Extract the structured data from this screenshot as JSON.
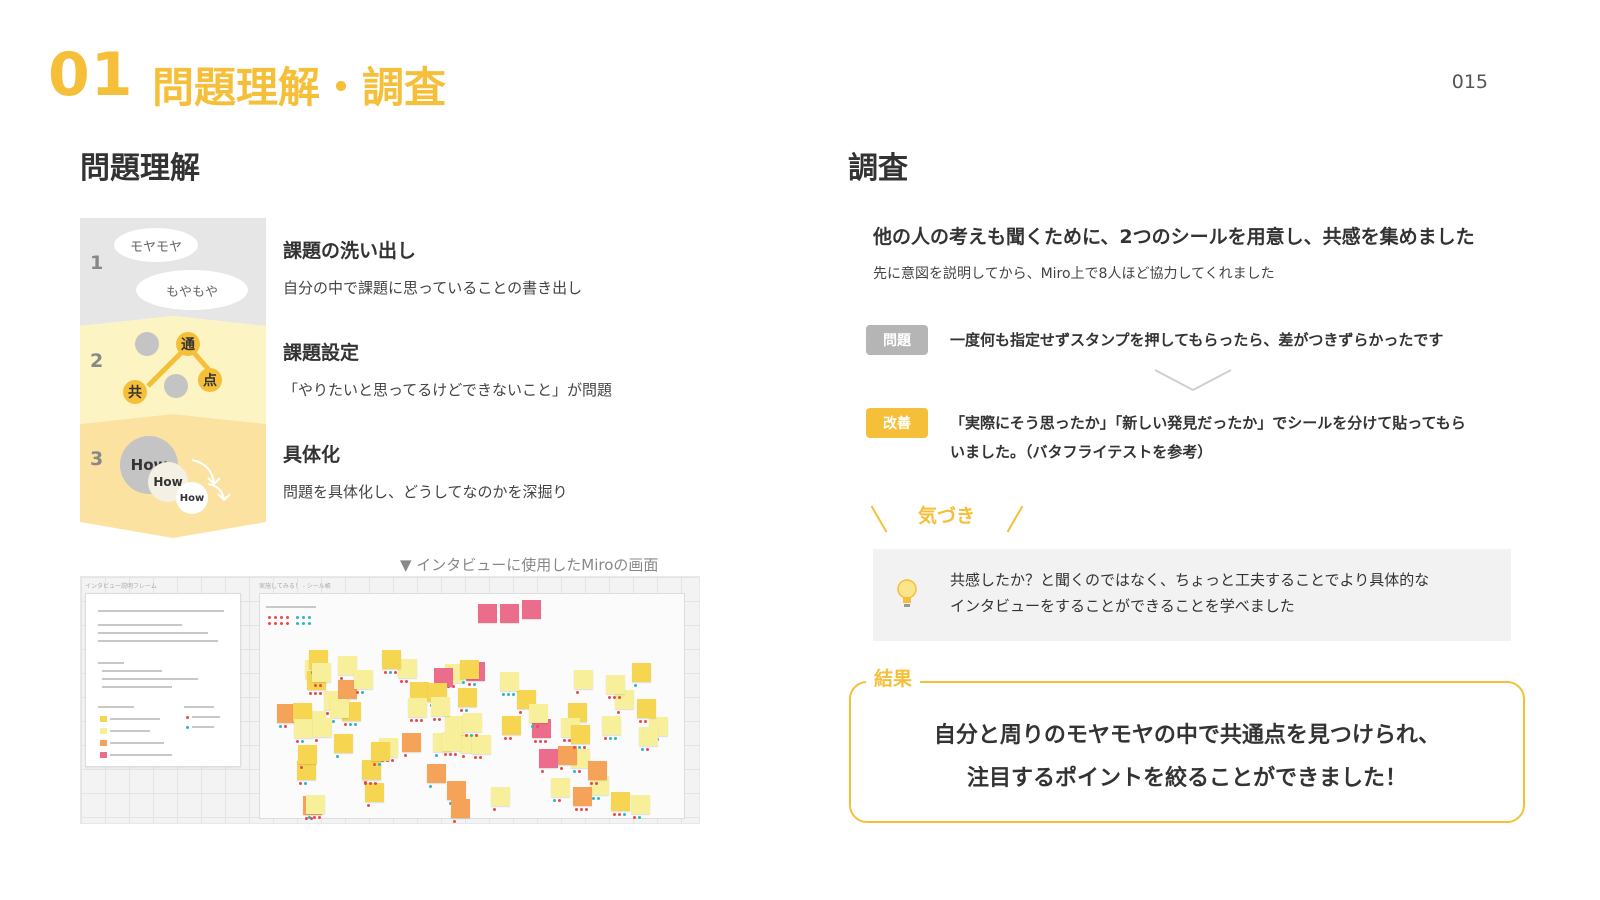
{
  "header": {
    "number": "01",
    "title": "問題理解・調査",
    "page": "015"
  },
  "left": {
    "title": "問題理解",
    "stages": [
      {
        "num": "1",
        "clouds": [
          "モヤモヤ",
          "もやもや"
        ]
      },
      {
        "num": "2",
        "nodes": [
          "通",
          "共",
          "点"
        ]
      },
      {
        "num": "3",
        "hows": [
          "How",
          "How",
          "How"
        ]
      }
    ],
    "steps": [
      {
        "title": "課題の洗い出し",
        "desc": "自分の中で課題に思っていることの書き出し"
      },
      {
        "title": "課題設定",
        "desc": "「やりたいと思ってるけどできないこと」が問題"
      },
      {
        "title": "具体化",
        "desc": "問題を具体化し、どうしてなのかを深掘り"
      }
    ],
    "caption": "▼ インタビューに使用したMiroの画面",
    "board": {
      "frame_left_label": "インタビュー説明フレーム",
      "frame_right_label": "実施してみる！ - シール帳"
    }
  },
  "right": {
    "title": "調査",
    "lead": "他の人の考えも聞くために、2つのシールを用意し、共感を集めました",
    "sub": "先に意図を説明してから、Miro上で8人ほど協力してくれました",
    "problem": {
      "tag": "問題",
      "text": "一度何も指定せずスタンプを押してもらったら、差がつきずらかったです"
    },
    "improve": {
      "tag": "改善",
      "text_l1": "「実際にそう思ったか」「新しい発見だったか」でシールを分けて貼ってもら",
      "text_l2": "いました。（バタフライテストを参考）"
    },
    "insight_label": "気づき",
    "insight": {
      "l1": "共感したか？と聞くのではなく、ちょっと工夫することでより具体的な",
      "l2": "インタビューをすることができることを学べました"
    },
    "result_label": "結果",
    "result": {
      "l1": "自分と周りのモヤモヤの中で共通点を見つけられ、",
      "l2": "注目するポイントを絞ることができました！"
    }
  },
  "colors": {
    "accent": "#f6bf3a",
    "tag_gray": "#b5b5b5",
    "stage1": "#e6e6e6",
    "stage2": "#fdf4c4",
    "stage3": "#fce2a0"
  }
}
